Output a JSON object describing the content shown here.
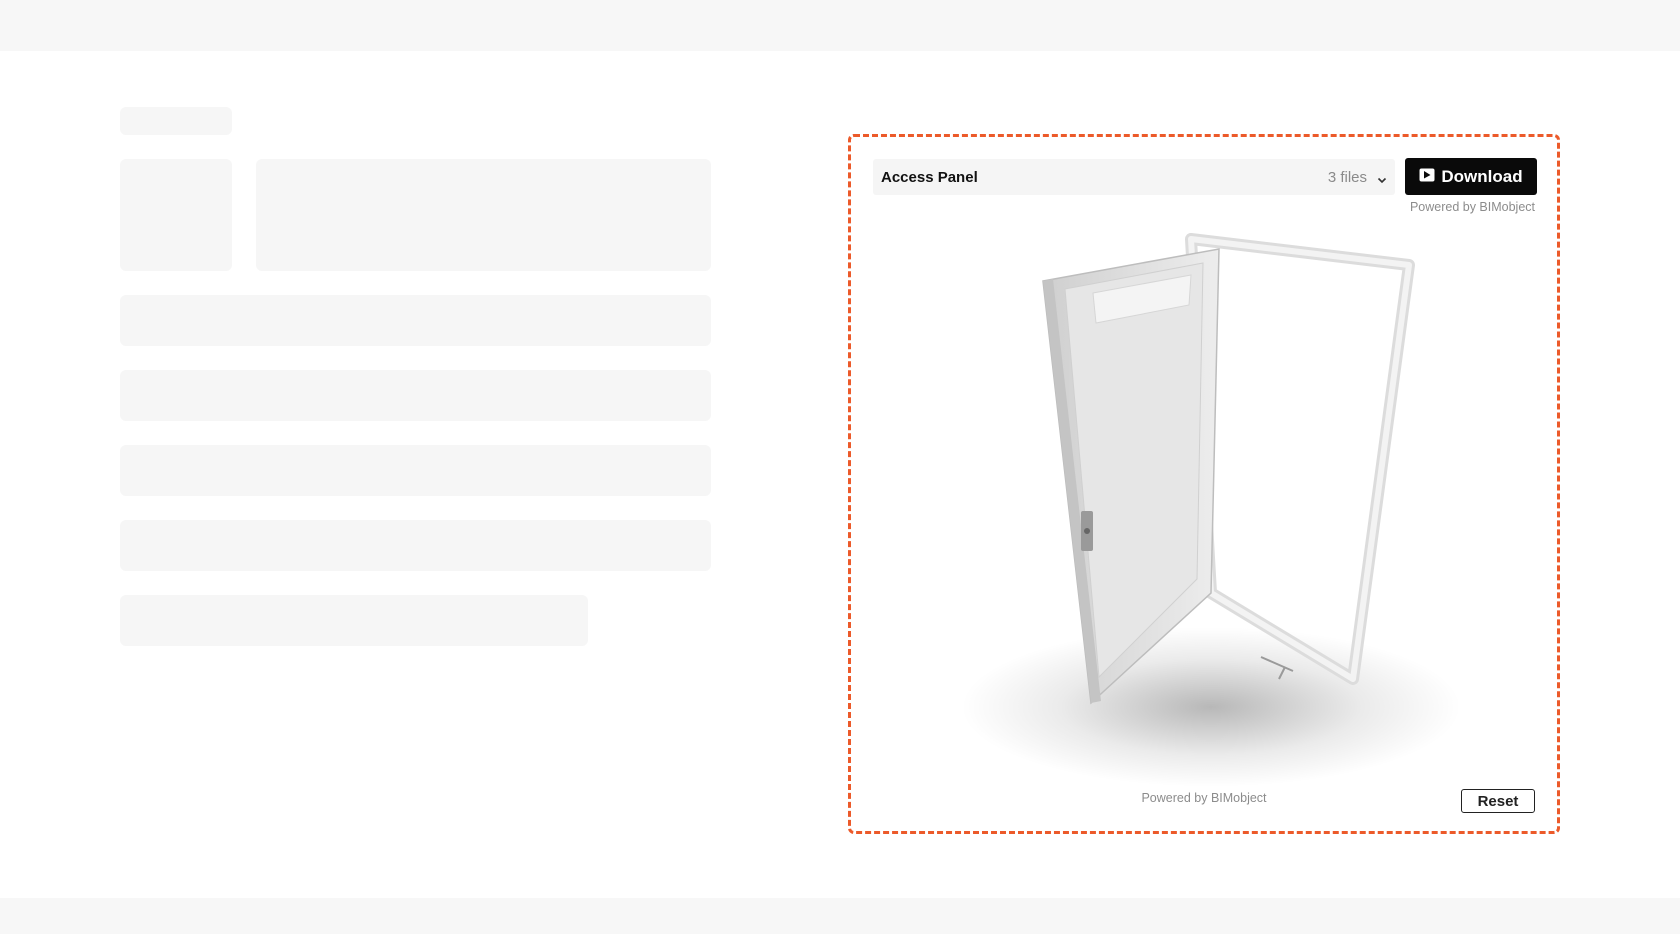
{
  "product": {
    "name": "Access Panel",
    "file_count_label": "3 files"
  },
  "actions": {
    "download_label": "Download",
    "reset_label": "Reset"
  },
  "branding": {
    "powered_top": "Powered by BIMobject",
    "powered_bottom": "Powered by BIMobject"
  },
  "colors": {
    "accent_border": "#ec5a2a",
    "skeleton": "#f6f6f6",
    "button_bg": "#0a0a0a"
  },
  "icons": {
    "download": "download-box-icon",
    "dropdown": "chevron-down-icon"
  }
}
